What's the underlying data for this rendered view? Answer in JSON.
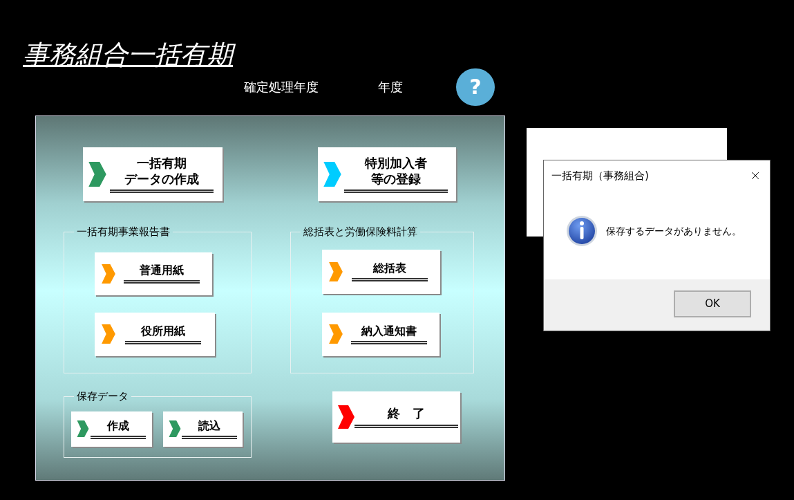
{
  "title": "事務組合一括有期",
  "fiscal_year": {
    "label": "確定処理年度",
    "unit": "年度"
  },
  "help_button": {
    "label": "?"
  },
  "top_buttons": [
    {
      "lines": [
        "一括有期",
        "データの作成"
      ],
      "color": "#2e9960"
    },
    {
      "lines": [
        "特別加入者",
        "等の登録"
      ],
      "color": "#00ccff"
    }
  ],
  "groups": [
    {
      "title": "一括有期事業報告書",
      "buttons": [
        {
          "label": "普通用紙",
          "color": "#ff9900"
        },
        {
          "label": "役所用紙",
          "color": "#ff9900"
        }
      ]
    },
    {
      "title": "総括表と労働保険料計算",
      "buttons": [
        {
          "label": "総括表",
          "color": "#ff9900"
        },
        {
          "label": "納入通知書",
          "color": "#ff9900"
        }
      ]
    }
  ],
  "save_group": {
    "title": "保存データ",
    "buttons": [
      {
        "label": "作成",
        "color": "#2e9960"
      },
      {
        "label": "読込",
        "color": "#2e9960"
      }
    ]
  },
  "exit_button": {
    "label": "終　了",
    "color": "#ff0000"
  },
  "dialog": {
    "title": "一括有期（事務組合)",
    "message": "保存するデータがありません。",
    "ok_button": "OK"
  }
}
